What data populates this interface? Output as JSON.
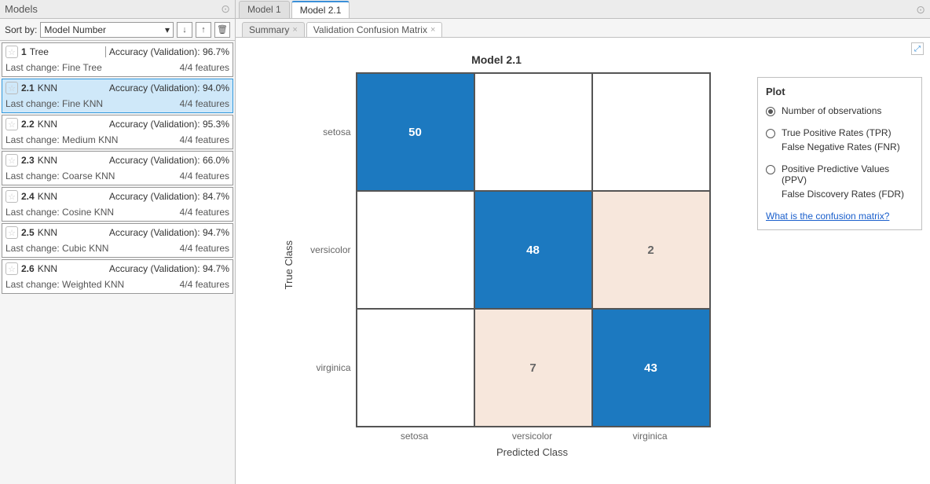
{
  "left": {
    "title": "Models",
    "sort_label": "Sort by:",
    "sort_value": "Model Number",
    "btn_down": "↓",
    "btn_up": "↑",
    "btn_trash": "🗑",
    "models": [
      {
        "id": "1",
        "type": "Tree",
        "acc": "Accuracy (Validation): 96.7%",
        "last": "Last change: Fine Tree",
        "feat": "4/4 features",
        "sel": false
      },
      {
        "id": "2.1",
        "type": "KNN",
        "acc": "Accuracy (Validation): 94.0%",
        "last": "Last change: Fine KNN",
        "feat": "4/4 features",
        "sel": true
      },
      {
        "id": "2.2",
        "type": "KNN",
        "acc": "Accuracy (Validation): 95.3%",
        "last": "Last change: Medium KNN",
        "feat": "4/4 features",
        "sel": false
      },
      {
        "id": "2.3",
        "type": "KNN",
        "acc": "Accuracy (Validation): 66.0%",
        "last": "Last change: Coarse KNN",
        "feat": "4/4 features",
        "sel": false
      },
      {
        "id": "2.4",
        "type": "KNN",
        "acc": "Accuracy (Validation): 84.7%",
        "last": "Last change: Cosine KNN",
        "feat": "4/4 features",
        "sel": false
      },
      {
        "id": "2.5",
        "type": "KNN",
        "acc": "Accuracy (Validation): 94.7%",
        "last": "Last change: Cubic KNN",
        "feat": "4/4 features",
        "sel": false
      },
      {
        "id": "2.6",
        "type": "KNN",
        "acc": "Accuracy (Validation): 94.7%",
        "last": "Last change: Weighted KNN",
        "feat": "4/4 features",
        "sel": false
      }
    ]
  },
  "tabs": {
    "top": [
      {
        "label": "Model 1",
        "active": false
      },
      {
        "label": "Model 2.1",
        "active": true
      }
    ],
    "sub": [
      {
        "label": "Summary",
        "active": false
      },
      {
        "label": "Validation Confusion Matrix",
        "active": true
      }
    ]
  },
  "plot_panel": {
    "title": "Plot",
    "opt1": "Number of observations",
    "opt2a": "True Positive Rates (TPR)",
    "opt2b": "False Negative Rates (FNR)",
    "opt3a": "Positive Predictive Values (PPV)",
    "opt3b": "False Discovery Rates (FDR)",
    "help": "What is the confusion matrix?"
  },
  "chart_data": {
    "type": "heatmap",
    "title": "Model 2.1",
    "xlabel": "Predicted Class",
    "ylabel": "True Class",
    "row_labels": [
      "setosa",
      "versicolor",
      "virginica"
    ],
    "col_labels": [
      "setosa",
      "versicolor",
      "virginica"
    ],
    "values": [
      [
        50,
        0,
        0
      ],
      [
        0,
        48,
        2
      ],
      [
        0,
        7,
        43
      ]
    ]
  }
}
